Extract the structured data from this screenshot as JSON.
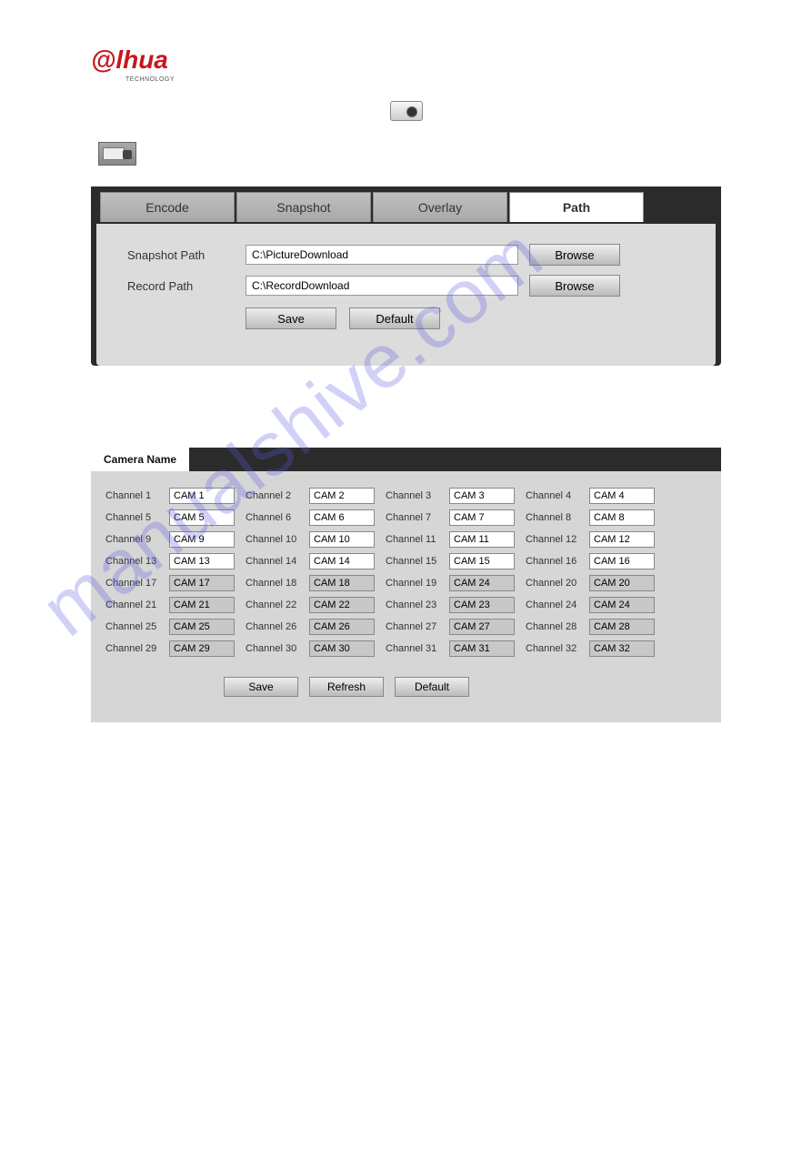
{
  "brand": {
    "name": "lhua",
    "sub": "TECHNOLOGY"
  },
  "watermark": "manualshive.com",
  "icons": {
    "camera": "camera-icon",
    "record": "record-camera-icon"
  },
  "panel1": {
    "tabs": [
      "Encode",
      "Snapshot",
      "Overlay",
      "Path"
    ],
    "activeTab": "Path",
    "rows": {
      "snapshot": {
        "label": "Snapshot Path",
        "value": "C:\\PictureDownload",
        "browse": "Browse"
      },
      "record": {
        "label": "Record Path",
        "value": "C:\\RecordDownload",
        "browse": "Browse"
      }
    },
    "buttons": {
      "save": "Save",
      "default": "Default"
    }
  },
  "panel2": {
    "tab": "Camera Name",
    "channels": [
      {
        "label": "Channel 1",
        "value": "CAM 1"
      },
      {
        "label": "Channel 2",
        "value": "CAM 2"
      },
      {
        "label": "Channel 3",
        "value": "CAM 3"
      },
      {
        "label": "Channel 4",
        "value": "CAM 4"
      },
      {
        "label": "Channel 5",
        "value": "CAM 5"
      },
      {
        "label": "Channel 6",
        "value": "CAM 6"
      },
      {
        "label": "Channel 7",
        "value": "CAM 7"
      },
      {
        "label": "Channel 8",
        "value": "CAM 8"
      },
      {
        "label": "Channel 9",
        "value": "CAM 9"
      },
      {
        "label": "Channel 10",
        "value": "CAM 10"
      },
      {
        "label": "Channel 11",
        "value": "CAM 11"
      },
      {
        "label": "Channel 12",
        "value": "CAM 12"
      },
      {
        "label": "Channel 13",
        "value": "CAM 13"
      },
      {
        "label": "Channel 14",
        "value": "CAM 14"
      },
      {
        "label": "Channel 15",
        "value": "CAM 15"
      },
      {
        "label": "Channel 16",
        "value": "CAM 16"
      },
      {
        "label": "Channel 17",
        "value": "CAM 17"
      },
      {
        "label": "Channel 18",
        "value": "CAM 18"
      },
      {
        "label": "Channel 19",
        "value": "CAM 24"
      },
      {
        "label": "Channel 20",
        "value": "CAM 20"
      },
      {
        "label": "Channel 21",
        "value": "CAM 21"
      },
      {
        "label": "Channel 22",
        "value": "CAM 22"
      },
      {
        "label": "Channel 23",
        "value": "CAM 23"
      },
      {
        "label": "Channel 24",
        "value": "CAM 24"
      },
      {
        "label": "Channel 25",
        "value": "CAM 25"
      },
      {
        "label": "Channel 26",
        "value": "CAM 26"
      },
      {
        "label": "Channel 27",
        "value": "CAM 27"
      },
      {
        "label": "Channel 28",
        "value": "CAM 28"
      },
      {
        "label": "Channel 29",
        "value": "CAM 29"
      },
      {
        "label": "Channel 30",
        "value": "CAM 30"
      },
      {
        "label": "Channel 31",
        "value": "CAM 31"
      },
      {
        "label": "Channel 32",
        "value": "CAM 32"
      }
    ],
    "shadedRowsStart": 16,
    "buttons": {
      "save": "Save",
      "refresh": "Refresh",
      "default": "Default"
    }
  }
}
